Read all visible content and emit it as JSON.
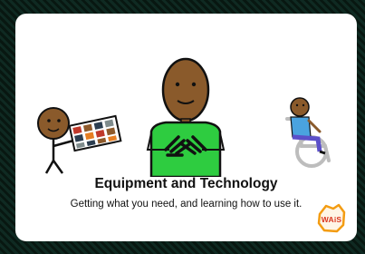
{
  "card": {
    "title": "Equipment and Technology",
    "subtitle": "Getting what you need, and learning how to use it.",
    "logo_text": "WAiS"
  },
  "icons": {
    "left_figure": "person-holding-communication-board-icon",
    "center_figure": "person-signing-icon",
    "right_figure": "person-in-wheelchair-icon",
    "logo": "wais-logo-icon"
  },
  "colors": {
    "background": "#0c1f1a",
    "card": "#ffffff",
    "shirt": "#2ecc40",
    "skin": "#8a5a2b",
    "wheelchair": "#bdbdbd",
    "logo_orange": "#f39c12",
    "logo_red": "#d9361f"
  }
}
